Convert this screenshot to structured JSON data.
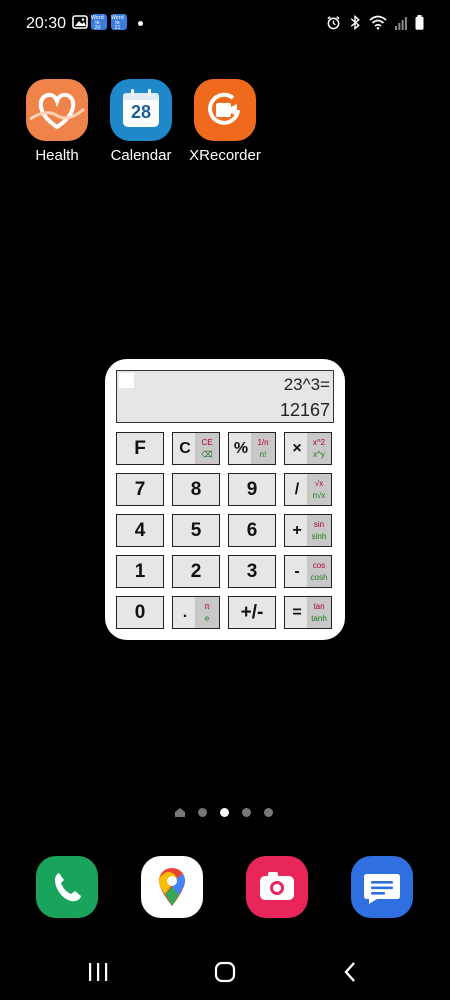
{
  "status_bar": {
    "time": "20:30",
    "wordle_tile_1": "Word\nle\n20",
    "wordle_tile_2": "Word\nle\n21",
    "icons": [
      "alarm-icon",
      "bluetooth-icon",
      "wifi-icon",
      "signal-icon",
      "battery-icon"
    ]
  },
  "apps": [
    {
      "label": "Health",
      "icon": "health-icon",
      "color": "#f0834a"
    },
    {
      "label": "Calendar",
      "icon": "calendar-icon",
      "color": "#1e88c9",
      "day": "28"
    },
    {
      "label": "XRecorder",
      "icon": "xrecorder-icon",
      "color": "#f06a1e"
    }
  ],
  "calculator": {
    "expression": "23^3=",
    "result": "12167",
    "keys": [
      {
        "main": "F"
      },
      {
        "main": "C",
        "top": "CE",
        "bot": "⌫"
      },
      {
        "main": "%",
        "top": "1/n",
        "bot": "n!"
      },
      {
        "main": "×",
        "top": "x^2",
        "bot": "x^y"
      },
      {
        "main": "7"
      },
      {
        "main": "8"
      },
      {
        "main": "9"
      },
      {
        "main": "/",
        "top": "√x",
        "bot": "n√x"
      },
      {
        "main": "4"
      },
      {
        "main": "5"
      },
      {
        "main": "6"
      },
      {
        "main": "+",
        "top": "sin",
        "bot": "sinh"
      },
      {
        "main": "1"
      },
      {
        "main": "2"
      },
      {
        "main": "3"
      },
      {
        "main": "-",
        "top": "cos",
        "bot": "cosh"
      },
      {
        "main": "0"
      },
      {
        "main": ".",
        "top": "π",
        "bot": "e"
      },
      {
        "main": "+/-"
      },
      {
        "main": "=",
        "top": "tan",
        "bot": "tanh"
      }
    ]
  },
  "pager": {
    "pages": 4,
    "active_index": 2
  },
  "dock": [
    {
      "icon": "phone-icon",
      "color": "#1aa35a"
    },
    {
      "icon": "maps-icon",
      "color": "#ffffff"
    },
    {
      "icon": "camera-icon",
      "color": "#e8265a"
    },
    {
      "icon": "messages-icon",
      "color": "#2f6fe0"
    }
  ],
  "navbar": [
    "recents-icon",
    "home-icon",
    "back-icon"
  ]
}
